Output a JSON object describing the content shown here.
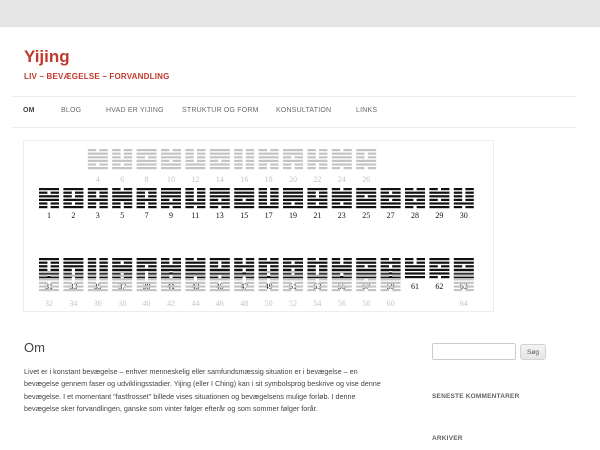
{
  "site": {
    "title": "Yijing",
    "tagline": "LIV – BEVÆGELSE – FORVANDLING"
  },
  "nav": {
    "items": [
      {
        "label": "OM",
        "active": true
      },
      {
        "label": "BLOG",
        "active": false
      },
      {
        "label": "HVAD ER YIJING",
        "active": false
      },
      {
        "label": "STRUKTUR OG FORM",
        "active": false
      },
      {
        "label": "KONSULTATION",
        "active": false
      },
      {
        "label": "LINKS",
        "active": false
      }
    ]
  },
  "banner": {
    "colors": {
      "dark": "#111111",
      "light": "#c4c4c4"
    },
    "row1_labels": [
      "4",
      "6",
      "8",
      "10",
      "12",
      "14",
      "16",
      "18",
      "20",
      "22",
      "24",
      "26"
    ],
    "row2_labels": [
      "1",
      "2",
      "3",
      "5",
      "7",
      "9",
      "11",
      "13",
      "15",
      "17",
      "19",
      "21",
      "23",
      "25",
      "27",
      "28",
      "29",
      "30"
    ],
    "row3_labels": [
      "31",
      "33",
      "35",
      "37",
      "39",
      "41",
      "43",
      "45",
      "47",
      "49",
      "51",
      "53",
      "55",
      "57",
      "59",
      "61",
      "62",
      "63"
    ],
    "row4_labels": [
      "32",
      "34",
      "36",
      "38",
      "40",
      "42",
      "44",
      "46",
      "48",
      "50",
      "52",
      "54",
      "56",
      "58",
      "60",
      "64"
    ]
  },
  "entry": {
    "title": "Om",
    "paragraph": "Livet er i konstant bevægelse – enhver menneskelig eller samfundsmæssig situation er i bevægelse – en bevægelse gennem faser og udviklingsstadier. Yijing (eller I Ching) kan i sit symbolsprog beskrive og vise denne bevægelse. I et momentant \"fastfrosset\" billede vises situationen og bevægelsens mulige forløb. I denne bevægelse sker forvandlingen, ganske som vinter følger efterår og som sommer følger forår."
  },
  "sidebar": {
    "search_button": "Søg",
    "recent_comments": "SENESTE KOMMENTARER",
    "archives": "ARKIVER"
  },
  "colors": {
    "accent": "#c0392b",
    "text": "#444444"
  }
}
